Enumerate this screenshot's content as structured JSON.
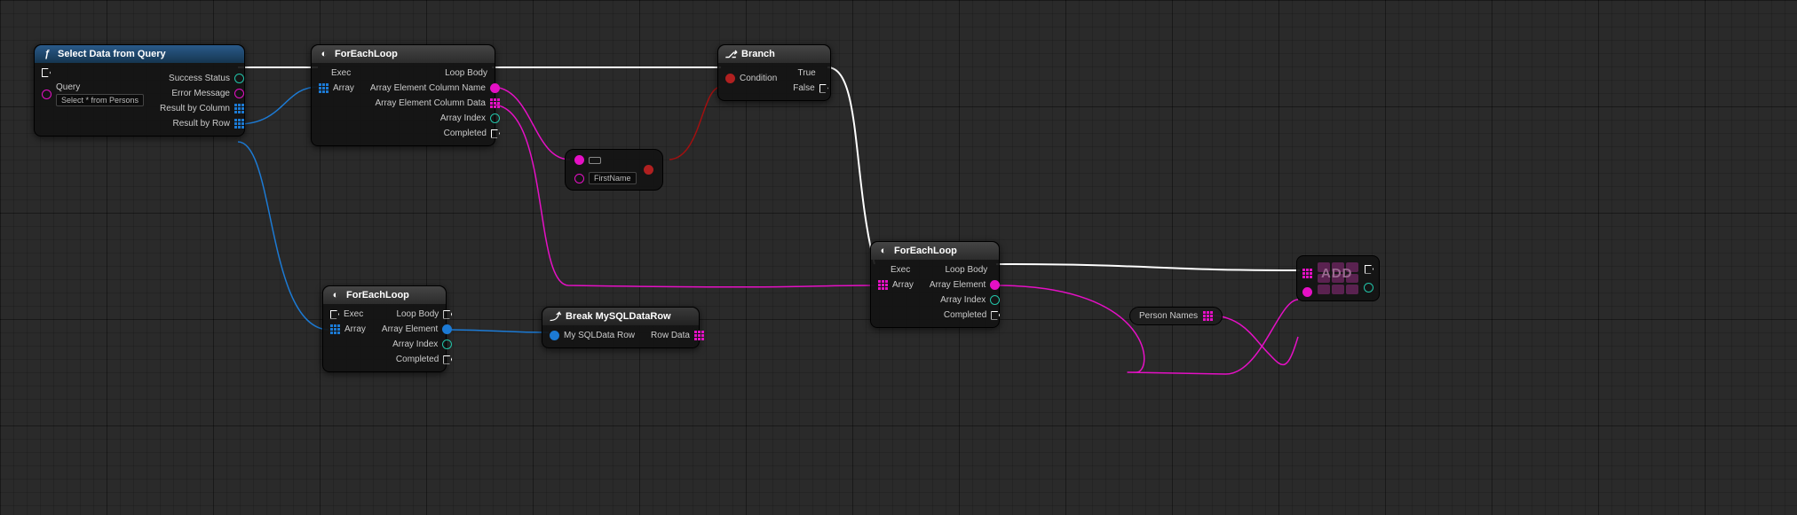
{
  "nodes": {
    "selectData": {
      "title": "Select Data from Query",
      "queryLabel": "Query",
      "queryValue": "Select * from Persons",
      "successStatus": "Success Status",
      "errorMessage": "Error Message",
      "resultByColumn": "Result by Column",
      "resultByRow": "Result by Row"
    },
    "forEach1": {
      "title": "ForEachLoop",
      "exec": "Exec",
      "array": "Array",
      "loopBody": "Loop Body",
      "arrayElementColName": "Array Element Column Name",
      "arrayElementColData": "Array Element Column Data",
      "arrayIndex": "Array Index",
      "completed": "Completed"
    },
    "branch": {
      "title": "Branch",
      "condition": "Condition",
      "true": "True",
      "false": "False"
    },
    "equals": {
      "value": "FirstName"
    },
    "forEach2": {
      "title": "ForEachLoop",
      "exec": "Exec",
      "array": "Array",
      "loopBody": "Loop Body",
      "arrayElement": "Array Element",
      "arrayIndex": "Array Index",
      "completed": "Completed"
    },
    "breakRow": {
      "title": "Break MySQLDataRow",
      "input": "My SQLData Row",
      "output": "Row Data"
    },
    "forEach3": {
      "title": "ForEachLoop",
      "exec": "Exec",
      "array": "Array",
      "loopBody": "Loop Body",
      "arrayElement": "Array Element",
      "arrayIndex": "Array Index",
      "completed": "Completed"
    },
    "personNames": {
      "label": "Person Names"
    },
    "add": {
      "label": "ADD"
    }
  }
}
